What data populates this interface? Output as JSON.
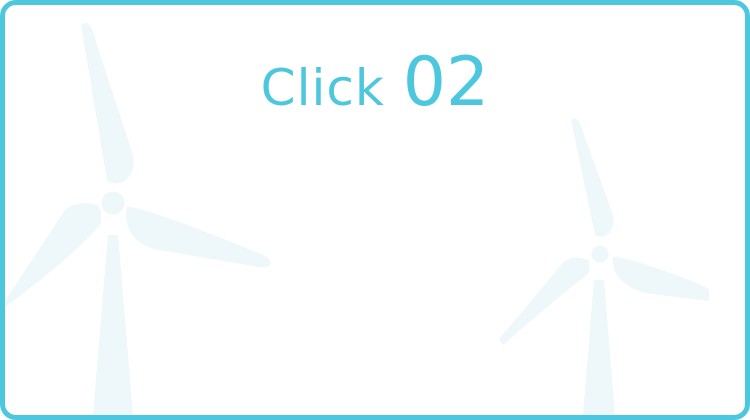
{
  "theme": {
    "accent": "#4cc7dd",
    "turbine": "#eef7f9"
  },
  "headline": {
    "word": "Click",
    "number": "02"
  },
  "background": {
    "decorations": [
      "wind-turbine-icon",
      "wind-turbine-icon"
    ]
  }
}
